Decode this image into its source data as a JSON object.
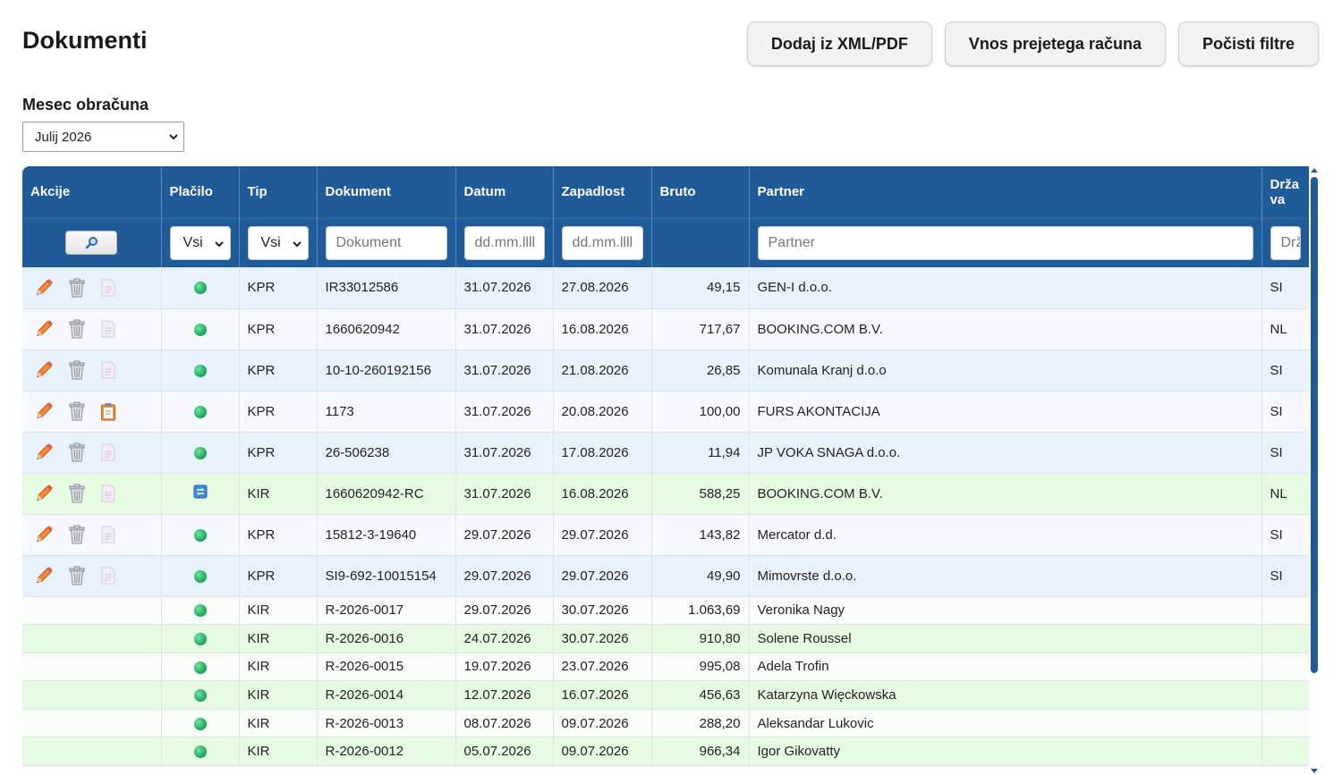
{
  "page": {
    "title": "Dokumenti"
  },
  "toolbar": {
    "import_label": "Dodaj iz XML/PDF",
    "incoming_invoice_label": "Vnos prejetega računa",
    "clear_filters_label": "Počisti filtre"
  },
  "month": {
    "label": "Mesec obračuna",
    "value": "Julij 2026"
  },
  "table": {
    "columns": [
      "Akcije",
      "Plačilo",
      "Tip",
      "Dokument",
      "Datum",
      "Zapadlost",
      "Bruto",
      "Partner",
      "Drža va"
    ],
    "filters": {
      "payment": "Vsi",
      "type": "Vsi",
      "document_placeholder": "Dokument",
      "date_placeholder": "dd.mm.llll",
      "due_placeholder": "dd.mm.llll",
      "partner_placeholder": "Partner",
      "country_placeholder": "Država"
    },
    "rows": [
      {
        "actions": true,
        "doc_icon": "file-icon",
        "status": "paid-dot",
        "type": "KPR",
        "document": "IR33012586",
        "date": "31.07.2026",
        "due": "27.08.2026",
        "gross": "49,15",
        "partner": "GEN-I d.o.o.",
        "country": "SI"
      },
      {
        "actions": true,
        "doc_icon": "file-icon",
        "status": "paid-dot",
        "type": "KPR",
        "document": "1660620942",
        "date": "31.07.2026",
        "due": "16.08.2026",
        "gross": "717,67",
        "partner": "BOOKING.COM B.V.",
        "country": "NL"
      },
      {
        "actions": true,
        "doc_icon": "file-icon",
        "status": "paid-dot",
        "type": "KPR",
        "document": "10-10-260192156",
        "date": "31.07.2026",
        "due": "21.08.2026",
        "gross": "26,85",
        "partner": "Komunala Kranj d.o.o",
        "country": "SI"
      },
      {
        "actions": true,
        "doc_icon": "clipboard-icon",
        "status": "paid-dot",
        "type": "KPR",
        "document": "1173",
        "date": "31.07.2026",
        "due": "20.08.2026",
        "gross": "100,00",
        "partner": "FURS AKONTACIJA",
        "country": "SI"
      },
      {
        "actions": true,
        "doc_icon": "file-icon",
        "status": "paid-dot",
        "type": "KPR",
        "document": "26-506238",
        "date": "31.07.2026",
        "due": "17.08.2026",
        "gross": "11,94",
        "partner": "JP VOKA SNAGA d.o.o.",
        "country": "SI"
      },
      {
        "actions": true,
        "doc_icon": "file-icon",
        "status": "transfer-icon",
        "type": "KIR",
        "document": "1660620942-RC",
        "date": "31.07.2026",
        "due": "16.08.2026",
        "gross": "588,25",
        "partner": "BOOKING.COM B.V.",
        "country": "NL"
      },
      {
        "actions": true,
        "doc_icon": "file-icon",
        "status": "paid-dot",
        "type": "KPR",
        "document": "15812-3-19640",
        "date": "29.07.2026",
        "due": "29.07.2026",
        "gross": "143,82",
        "partner": "Mercator d.d.",
        "country": "SI"
      },
      {
        "actions": true,
        "doc_icon": "file-icon",
        "status": "paid-dot",
        "type": "KPR",
        "document": "SI9-692-10015154",
        "date": "29.07.2026",
        "due": "29.07.2026",
        "gross": "49,90",
        "partner": "Mimovrste d.o.o.",
        "country": "SI"
      },
      {
        "actions": false,
        "status": "paid-dot",
        "type": "KIR",
        "document": "R-2026-0017",
        "date": "29.07.2026",
        "due": "30.07.2026",
        "gross": "1.063,69",
        "partner": "Veronika Nagy",
        "country": ""
      },
      {
        "actions": false,
        "status": "paid-dot",
        "type": "KIR",
        "document": "R-2026-0016",
        "date": "24.07.2026",
        "due": "30.07.2026",
        "gross": "910,80",
        "partner": "Solene Roussel",
        "country": ""
      },
      {
        "actions": false,
        "status": "paid-dot",
        "type": "KIR",
        "document": "R-2026-0015",
        "date": "19.07.2026",
        "due": "23.07.2026",
        "gross": "995,08",
        "partner": "Adela Trofin",
        "country": ""
      },
      {
        "actions": false,
        "status": "paid-dot",
        "type": "KIR",
        "document": "R-2026-0014",
        "date": "12.07.2026",
        "due": "16.07.2026",
        "gross": "456,63",
        "partner": "Katarzyna Więckowska",
        "country": ""
      },
      {
        "actions": false,
        "status": "paid-dot",
        "type": "KIR",
        "document": "R-2026-0013",
        "date": "08.07.2026",
        "due": "09.07.2026",
        "gross": "288,20",
        "partner": "Aleksandar Lukovic",
        "country": ""
      },
      {
        "actions": false,
        "status": "paid-dot",
        "type": "KIR",
        "document": "R-2026-0012",
        "date": "05.07.2026",
        "due": "09.07.2026",
        "gross": "966,34",
        "partner": "Igor Gikovatty",
        "country": ""
      }
    ]
  },
  "colors": {
    "header_bg": "#1f5a99",
    "kpr_row_bg": "#e8f2fd",
    "kir_row_bg": "#e7fbe3",
    "paid_dot": "#16a35a",
    "edit_pencil": "#e8682a"
  }
}
